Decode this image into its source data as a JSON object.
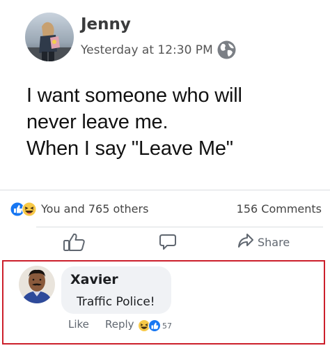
{
  "post": {
    "author_name": "Jenny",
    "timestamp": "Yesterday at 12:30 PM",
    "audience_icon": "globe-icon",
    "text_lines": [
      "I want someone who will",
      "never leave me.",
      "When I say \"Leave Me\""
    ]
  },
  "stats": {
    "reactions_label": "You and 765 others",
    "reaction_icons": [
      "like-icon",
      "haha-icon"
    ],
    "comments_label": "156  Comments"
  },
  "actions": {
    "like_icon": "thumbs-up-icon",
    "comment_icon": "comment-icon",
    "share_label": "Share"
  },
  "comment": {
    "author_name": "Xavier",
    "text": "Traffic Police!",
    "like_label": "Like",
    "reply_label": "Reply",
    "reaction_icons": [
      "haha-icon",
      "like-icon"
    ],
    "reaction_count": "57"
  },
  "colors": {
    "highlight_border": "#cc1f2b",
    "like_blue": "#1877f2",
    "haha_yellow": "#f7c948"
  }
}
